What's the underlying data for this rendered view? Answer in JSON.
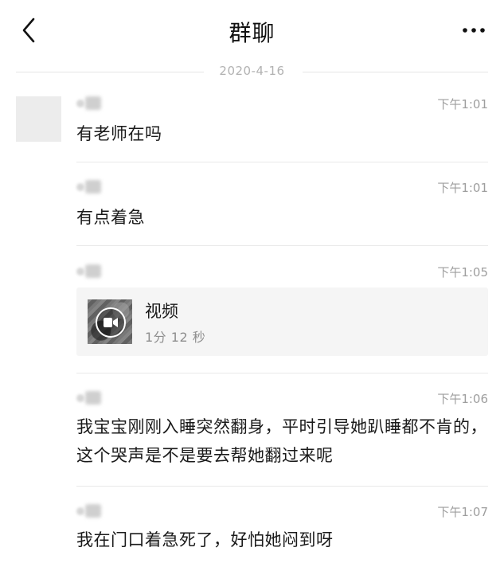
{
  "header": {
    "title": "群聊",
    "back_icon": "chevron-left-icon",
    "more_icon": "more-horizontal-icon"
  },
  "date_divider": "2020-4-16",
  "messages": [
    {
      "time": "下午1:01",
      "text": "有老师在吗"
    },
    {
      "time": "下午1:01",
      "text": "有点着急"
    },
    {
      "time": "下午1:05",
      "video": {
        "label": "视频",
        "duration": "1分 12 秒"
      }
    },
    {
      "time": "下午1:06",
      "text": "我宝宝刚刚入睡突然翻身，平时引导她趴睡都不肯的，这个哭声是不是要去帮她翻过来呢"
    },
    {
      "time": "下午1:07",
      "text": "我在门口着急死了，好怕她闷到呀"
    }
  ],
  "colors": {
    "separator": "#e9e9e9",
    "time_text": "#9e9e9e",
    "video_card_bg": "#f5f5f5"
  }
}
